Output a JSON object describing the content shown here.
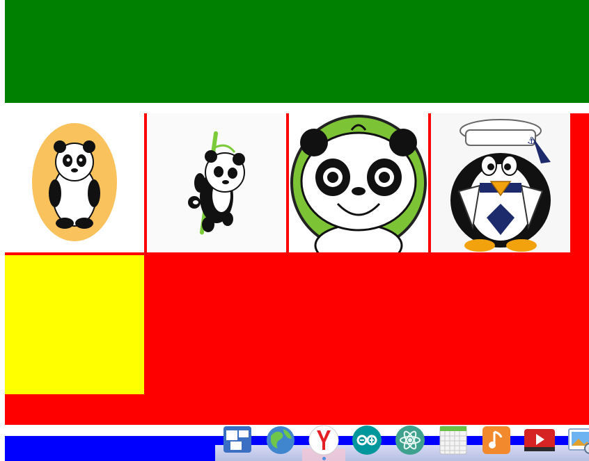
{
  "colors": {
    "header": "#008000",
    "canvas": "#ff0000",
    "placeholder": "#ffff00",
    "taskbar": "#0000ff"
  },
  "gallery": {
    "images": [
      {
        "icon": "panda-standing-icon"
      },
      {
        "icon": "panda-bamboo-icon"
      },
      {
        "icon": "panda-face-icon"
      },
      {
        "icon": "sailor-penguin-icon"
      }
    ]
  },
  "dock": {
    "items": [
      {
        "icon": "workspaces-icon"
      },
      {
        "icon": "globe-browser-icon"
      },
      {
        "icon": "yandex-browser-icon",
        "active": true
      },
      {
        "icon": "arduino-icon"
      },
      {
        "icon": "atom-editor-icon"
      },
      {
        "icon": "calendar-icon"
      },
      {
        "icon": "music-player-icon"
      },
      {
        "icon": "video-player-icon"
      },
      {
        "icon": "image-viewer-icon"
      }
    ]
  }
}
